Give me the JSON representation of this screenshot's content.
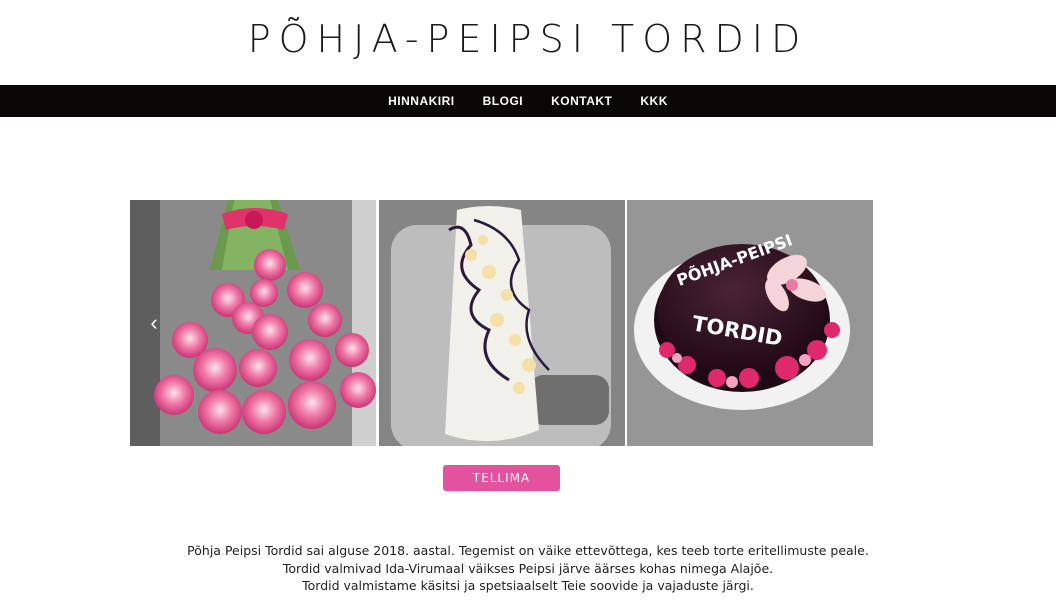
{
  "header": {
    "title": "PÕHJA-PEIPSI TORDID"
  },
  "nav": {
    "items": [
      "HINNAKIRI",
      "BLOGI",
      "KONTAKT",
      "KKK"
    ]
  },
  "carousel": {
    "prev_icon": "chevron-left-icon",
    "prev_glyph": "‹",
    "slides": [
      {
        "name": "rose-bouquet-cake"
      },
      {
        "name": "white-cream-cake"
      },
      {
        "name": "chocolate-glazed-cake",
        "cake_text_top": "PÕHJA-PEIPSI",
        "cake_text_bottom": "TORDID"
      }
    ]
  },
  "order_button": {
    "label": "TELLIMA"
  },
  "intro": {
    "lines": [
      "Põhja Peipsi Tordid sai alguse 2018. aastal. Tegemist on väike ettevõttega, kes teeb torte eritellimuste peale.",
      "Tordid valmivad Ida-Virumaal väikses Peipsi järve äärses kohas nimega Alajõe.",
      "Tordid valmistame käsitsi ja spetsiaalselt Teie soovide ja vajaduste järgi."
    ]
  },
  "colors": {
    "navbar": "#0b0707",
    "accent": "#e4529e",
    "text": "#222222"
  }
}
